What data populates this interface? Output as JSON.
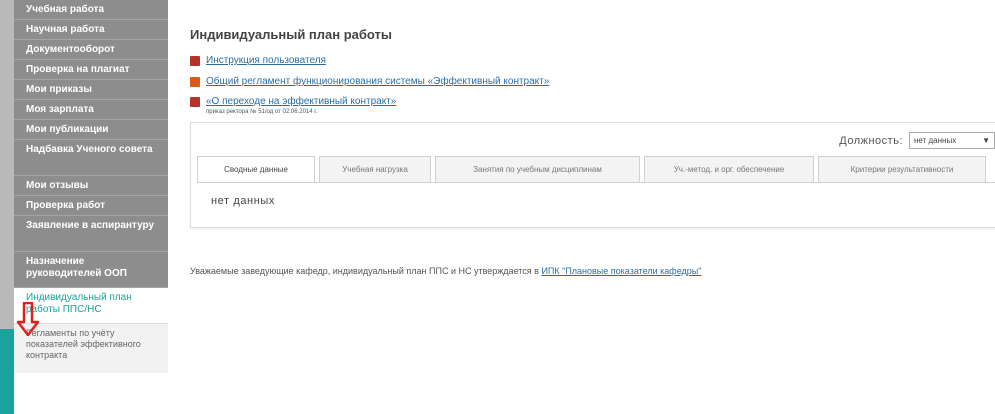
{
  "sidebar": {
    "items": [
      {
        "label": "Учебная работа"
      },
      {
        "label": "Научная работа"
      },
      {
        "label": "Документооборот"
      },
      {
        "label": "Проверка на плагиат"
      },
      {
        "label": "Мои приказы"
      },
      {
        "label": "Моя зарплата"
      },
      {
        "label": "Мои публикации"
      },
      {
        "label": "Надбавка Ученого совета"
      },
      {
        "label": "Мои отзывы"
      },
      {
        "label": "Проверка работ"
      },
      {
        "label": "Заявление в аспирантуру"
      },
      {
        "label": "Назначение руководителей ООП"
      },
      {
        "label": "Индивидуальный план работы ППС/НС"
      },
      {
        "label": "Регламенты по учёту показателей эффективного контракта"
      }
    ]
  },
  "main": {
    "title": "Индивидуальный план работы",
    "links": [
      {
        "text": "Инструкция пользователя",
        "icon": "pdf-icon"
      },
      {
        "text": "Общий регламент функционирования системы «Эффективный контракт»",
        "icon": "ppt-icon"
      },
      {
        "text": "«О переходе на эффективный контракт»",
        "icon": "pdf-icon"
      }
    ],
    "link_note": "приказ ректора № 51/од от 02.06.2014 г.",
    "position_label": "Должность:",
    "position_value": "нет данных",
    "tabs": [
      "Сводные данные",
      "Учебная нагрузка",
      "Занятия по учебным дисциплинам",
      "Уч.-метод. и орг. обеспечение",
      "Критерии результативности"
    ],
    "no_data": "нет данных",
    "notice_text": "Уважаемые заведующие кафедр, индивидуальный план ППС и НС утверждается в ",
    "notice_link": "ИПК \"Плановые показатели кафедры\""
  },
  "colors": {
    "sidebar_bg": "#8d8d8d",
    "accent": "#1aa39a",
    "link": "#2a6ea6",
    "arrow": "#e0201a"
  }
}
